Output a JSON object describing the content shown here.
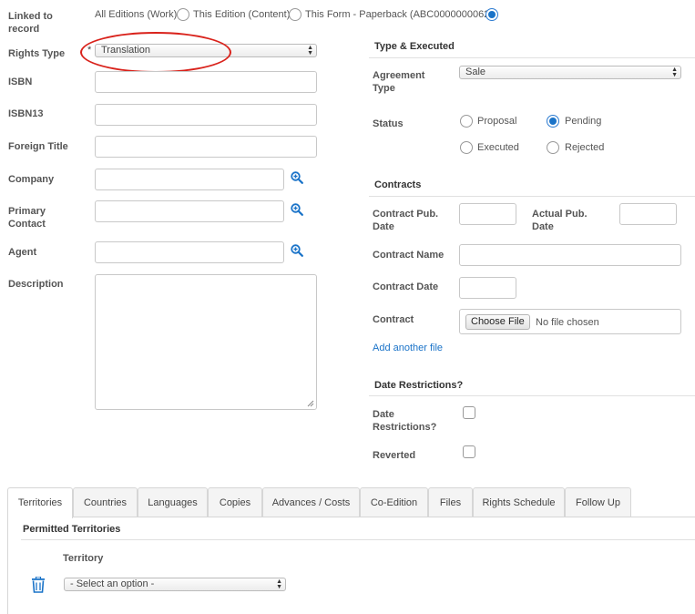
{
  "left": {
    "linked_label": "Linked to record",
    "linked_options": [
      {
        "label": "All Editions (Work)",
        "checked": false
      },
      {
        "label": "This Edition (Content)",
        "checked": false
      },
      {
        "label": "This Form - Paperback (ABC0000000062)",
        "checked": true
      }
    ],
    "rights_type_label": "Rights Type",
    "rights_type_required": "*",
    "rights_type_value": "Translation",
    "isbn_label": "ISBN",
    "isbn13_label": "ISBN13",
    "foreign_title_label": "Foreign Title",
    "company_label": "Company",
    "primary_contact_label": "Primary Contact",
    "agent_label": "Agent",
    "description_label": "Description"
  },
  "right": {
    "type_executed_heading": "Type & Executed",
    "agreement_type_label": "Agreement Type",
    "agreement_type_value": "Sale",
    "status_label": "Status",
    "status_options": [
      {
        "label": "Proposal",
        "checked": false
      },
      {
        "label": "Pending",
        "checked": true
      },
      {
        "label": "Executed",
        "checked": false
      },
      {
        "label": "Rejected",
        "checked": false
      }
    ],
    "contracts_heading": "Contracts",
    "contract_pub_date_label": "Contract Pub. Date",
    "actual_pub_date_label": "Actual Pub. Date",
    "contract_name_label": "Contract Name",
    "contract_date_label": "Contract Date",
    "contract_label": "Contract",
    "choose_file_label": "Choose File",
    "no_file_text": "No file chosen",
    "add_another_file": "Add another file",
    "date_restrictions_heading": "Date Restrictions?",
    "date_restrictions_label": "Date Restrictions?",
    "reverted_label": "Reverted"
  },
  "tabs": [
    "Territories",
    "Countries",
    "Languages",
    "Copies",
    "Advances / Costs",
    "Co-Edition",
    "Files",
    "Rights Schedule",
    "Follow Up"
  ],
  "active_tab": "Territories",
  "territories": {
    "heading": "Permitted Territories",
    "territory_label": "Territory",
    "territory_select_value": "- Select an option -"
  },
  "colors": {
    "accent": "#1a73c8",
    "annotation": "#d9221b"
  },
  "icons": {
    "lookup": "magnifier-plus-icon",
    "delete": "trash-icon"
  }
}
